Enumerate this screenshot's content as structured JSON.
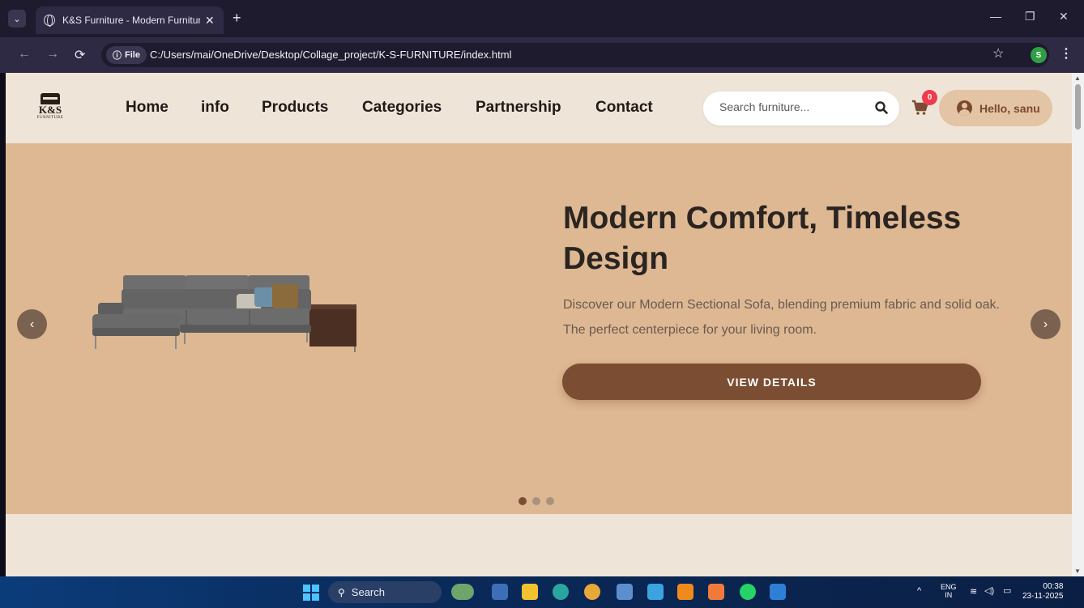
{
  "browser": {
    "tab_title": "K&S Furniture - Modern Furniture",
    "tab_close": "✕",
    "new_tab": "+",
    "file_chip": "File",
    "url": "C:/Users/mai/OneDrive/Desktop/Collage_project/K-S-FURNITURE/index.html",
    "profile_initial": "S",
    "window_controls": {
      "minimize": "—",
      "restore": "❐",
      "close": "✕"
    }
  },
  "site": {
    "logo": {
      "main": "K&S",
      "sub": "FURNITURE"
    },
    "nav": [
      "Home",
      "info",
      "Products",
      "Categories",
      "Partnership",
      "Contact"
    ],
    "search": {
      "placeholder": "Search furniture...",
      "value": ""
    },
    "cart": {
      "count": "0"
    },
    "user": {
      "greeting": "Hello, sanu"
    }
  },
  "hero": {
    "title": "Modern Comfort, Timeless Design",
    "description": "Discover our Modern Sectional Sofa, blending premium fabric and solid oak. The perfect centerpiece for your living room.",
    "cta_label": "VIEW DETAILS",
    "prev_label": "‹",
    "next_label": "›",
    "slides_total": 3,
    "active_slide": 1,
    "image": "sofa-image",
    "colors": {
      "background": "#ddb893",
      "button": "#7b4e33",
      "arrows": "#7b6250"
    }
  },
  "taskbar": {
    "search_label": "Search",
    "lang_top": "ENG",
    "lang_bottom": "IN",
    "time": "00:38",
    "date": "23-11-2025"
  }
}
